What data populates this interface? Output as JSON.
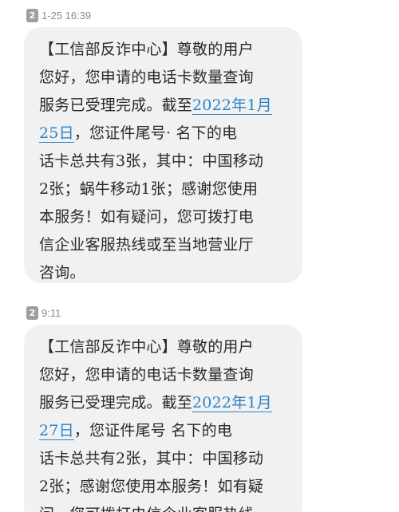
{
  "messages": [
    {
      "sim": "2",
      "time": "1-25 16:39",
      "lines": [
        [
          {
            "t": "【工信部反诈中心】尊敬的用户"
          }
        ],
        [
          {
            "t": "您好，您申请的电话卡数量查询"
          }
        ],
        [
          {
            "t": "服务已受理完成。截至"
          },
          {
            "t": "2022年1月",
            "link": true
          }
        ],
        [
          {
            "t": "25日",
            "link": true
          },
          {
            "t": "，您证件尾号·    名下的电"
          }
        ],
        [
          {
            "t": "话卡总共有3张，其中：中国移动"
          }
        ],
        [
          {
            "t": "2张；蜗牛移动1张；感谢您使用"
          }
        ],
        [
          {
            "t": "本服务！如有疑问，您可拨打电"
          }
        ],
        [
          {
            "t": "信企业客服热线或至当地营业厅"
          }
        ],
        [
          {
            "t": "咨询。"
          }
        ]
      ]
    },
    {
      "sim": "2",
      "time": "9:11",
      "lines": [
        [
          {
            "t": "【工信部反诈中心】尊敬的用户"
          }
        ],
        [
          {
            "t": "您好，您申请的电话卡数量查询"
          }
        ],
        [
          {
            "t": "服务已受理完成。截至"
          },
          {
            "t": "2022年1月",
            "link": true
          }
        ],
        [
          {
            "t": "27日",
            "link": true
          },
          {
            "t": "，您证件尾号    名下的电"
          }
        ],
        [
          {
            "t": "话卡总共有2张，其中：中国移动"
          }
        ],
        [
          {
            "t": "2张；感谢您使用本服务！如有疑"
          }
        ],
        [
          {
            "t": "问，您可拨打电信企业客服热线"
          }
        ]
      ]
    }
  ]
}
